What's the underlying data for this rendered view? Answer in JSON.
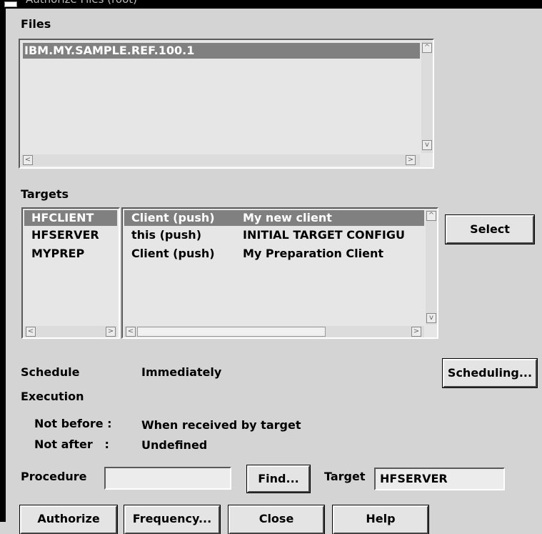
{
  "window": {
    "title": "Authorize Files (root)"
  },
  "files": {
    "label": "Files",
    "items": [
      "IBM.MY.SAMPLE.REF.100.1"
    ]
  },
  "targets": {
    "label": "Targets",
    "rows": [
      {
        "name": "HFCLIENT",
        "type": "Client (push)",
        "description": "My new client",
        "selected": true
      },
      {
        "name": "HFSERVER",
        "type": "this (push)",
        "description": "INITIAL TARGET CONFIGU",
        "selected": false
      },
      {
        "name": "MYPREP",
        "type": "Client (push)",
        "description": "My Preparation Client",
        "selected": false
      }
    ],
    "select_button": "Select"
  },
  "schedule": {
    "label": "Schedule",
    "value": "Immediately",
    "button": "Scheduling..."
  },
  "execution": {
    "label": "Execution",
    "not_before_label": "Not before :",
    "not_before_value": "When received by target",
    "not_after_label": "Not after   :",
    "not_after_value": "Undefined"
  },
  "procedure": {
    "label": "Procedure",
    "value": "",
    "find_button": "Find..."
  },
  "target": {
    "label": "Target",
    "value": "HFSERVER"
  },
  "buttons": {
    "authorize": "Authorize",
    "frequency": "Frequency...",
    "close": "Close",
    "help": "Help"
  },
  "scroll_glyphs": {
    "up": "^",
    "down": "v",
    "left": "<",
    "right": ">"
  }
}
